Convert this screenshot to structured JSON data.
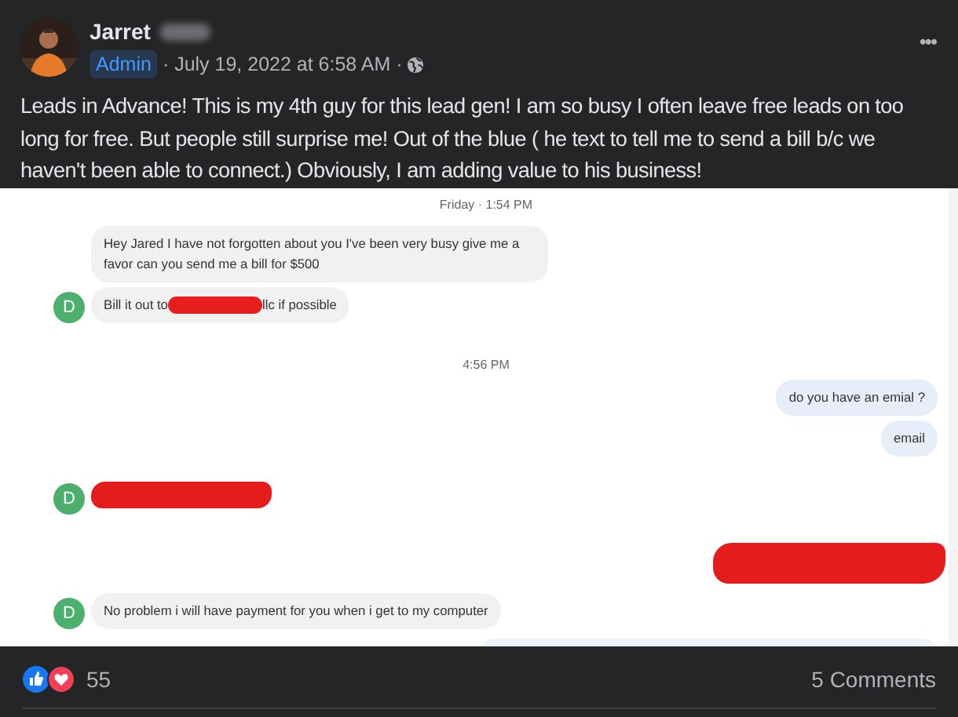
{
  "post": {
    "author": "Jarret",
    "author_surname_blurred": true,
    "role_badge": "Admin",
    "timestamp": "· July 19, 2022 at 6:58 AM ·",
    "more_button": "•••",
    "body": "Leads in Advance! This is my 4th guy for this lead gen! I am so busy I often leave free leads on too long for free. But people still surprise me! Out of the blue ( he text to tell me to send a bill b/c we haven't been able to connect.) Obviously, I am adding value to his business!"
  },
  "chat_screenshot": {
    "messages": [
      {
        "kind": "timestamp",
        "text": "Friday · 1:54 PM"
      },
      {
        "kind": "incoming",
        "parts": [
          {
            "kind": "text",
            "text": "Hey Jared I have not forgotten about you I've been very busy give me a favor can you send me a bill for $500"
          }
        ]
      },
      {
        "kind": "incoming",
        "avatar": "D",
        "parts": [
          {
            "kind": "text",
            "text": "Bill it out to"
          },
          {
            "kind": "redaction"
          },
          {
            "kind": "text",
            "text": "llc if possible"
          }
        ]
      },
      {
        "kind": "timestamp",
        "text": "4:56 PM"
      },
      {
        "kind": "outgoing",
        "parts": [
          {
            "kind": "text",
            "text": "do you have an emial ?"
          }
        ]
      },
      {
        "kind": "outgoing",
        "parts": [
          {
            "kind": "text",
            "text": "email"
          }
        ]
      },
      {
        "kind": "incoming",
        "avatar": "D",
        "parts": [
          {
            "kind": "redaction"
          }
        ]
      },
      {
        "kind": "outgoing",
        "parts": [
          {
            "kind": "redaction"
          }
        ]
      },
      {
        "kind": "incoming",
        "avatar": "D",
        "parts": [
          {
            "kind": "text",
            "text": "No problem i will have payment for you when i get to my computer"
          }
        ]
      },
      {
        "kind": "outgoing_cut"
      }
    ]
  },
  "footer": {
    "reaction_count": "55",
    "comments": "5 Comments"
  }
}
